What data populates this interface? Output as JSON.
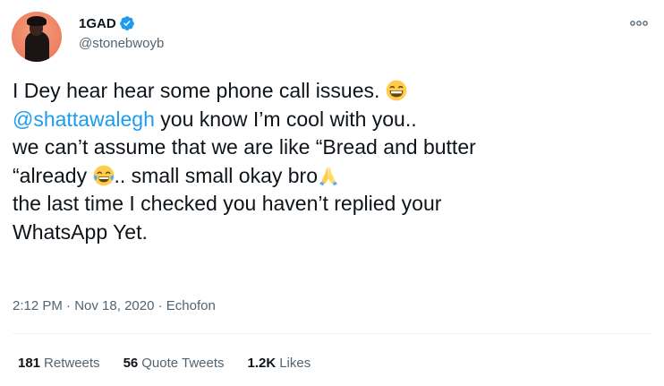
{
  "author": {
    "display_name": "1GAD",
    "handle": "@stonebwoyb",
    "verified": true
  },
  "tweet": {
    "line1_text": "I Dey hear hear some phone call issues.",
    "line1_emoji": "grinning-face-with-smiling-eyes",
    "line2_mention": "@shattawalegh",
    "line2_text": " you know I’m cool with you..",
    "line3_text": "we can’t assume that we are like “Bread and butter",
    "line4_text_a": "“already",
    "line4_emoji": "face-with-tears-of-joy",
    "line4_text_b": ".. small small okay bro",
    "line4_emoji2": "folded-hands",
    "line5_text": "the last time I checked you haven’t replied your",
    "line6_text": "WhatsApp Yet."
  },
  "meta": {
    "time": "2:12 PM",
    "separator": "·",
    "date": "Nov 18, 2020",
    "source": "Echofon"
  },
  "stats": {
    "retweets_count": "181",
    "retweets_label": "Retweets",
    "quotes_count": "56",
    "quotes_label": "Quote Tweets",
    "likes_count": "1.2K",
    "likes_label": "Likes"
  },
  "colors": {
    "link": "#1d9bf0",
    "text": "#0f1419",
    "secondary": "#536471",
    "verified": "#1d9bf0"
  }
}
